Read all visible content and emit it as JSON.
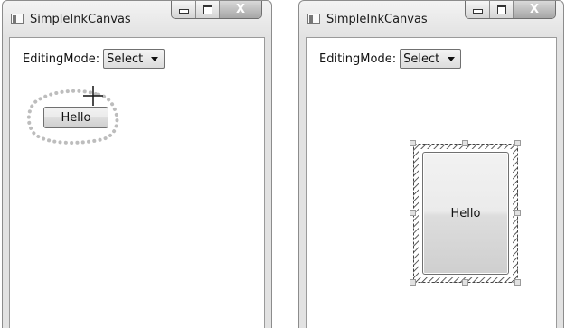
{
  "windows": [
    {
      "title": "SimpleInkCanvas",
      "caption": {
        "minimize": "",
        "maximize": "",
        "close": "X"
      },
      "toolbar": {
        "label": "EditingMode:",
        "mode_value": "Select"
      },
      "canvas": {
        "button_label": "Hello"
      }
    },
    {
      "title": "SimpleInkCanvas",
      "caption": {
        "minimize": "",
        "maximize": "",
        "close": "X"
      },
      "toolbar": {
        "label": "EditingMode:",
        "mode_value": "Select"
      },
      "canvas": {
        "button_label": "Hello"
      }
    }
  ],
  "icons": [
    "app-icon",
    "minimize-icon",
    "maximize-icon",
    "close-icon",
    "dropdown-arrow-icon",
    "crosshair-cursor-icon",
    "resize-handle-icon"
  ],
  "colors": {
    "window_frame": "#8c8c8c",
    "lasso_dots": "#bdbdbd",
    "close_button": "#a6a6a6"
  }
}
